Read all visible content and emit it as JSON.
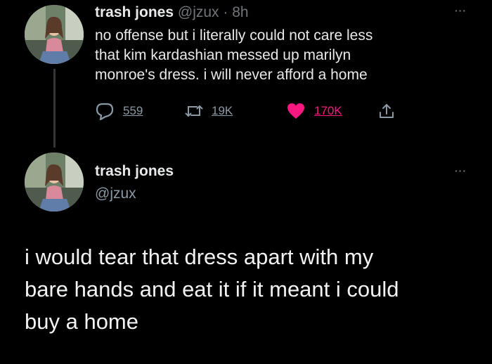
{
  "tweet": {
    "author_name": "trash jones",
    "author_handle": "@jzux",
    "separator": "·",
    "timestamp": "8h",
    "text_lines": [
      "no offense but i literally could not care less",
      "that kim kardashian messed up marilyn",
      "monroe's dress. i will never afford a home"
    ],
    "more_label": "···",
    "actions": {
      "reply_icon": "reply-icon",
      "reply_count": "559",
      "retweet_icon": "retweet-icon",
      "retweet_count": "19K",
      "like_icon": "heart-icon",
      "like_count": "170K",
      "like_color": "#f91880",
      "share_icon": "share-icon"
    }
  },
  "reply": {
    "author_name": "trash jones",
    "author_handle": "@jzux",
    "more_label": "···",
    "text_lines": [
      "i would tear that dress apart with my",
      "bare hands and eat it if it meant i could",
      "buy a home"
    ]
  }
}
